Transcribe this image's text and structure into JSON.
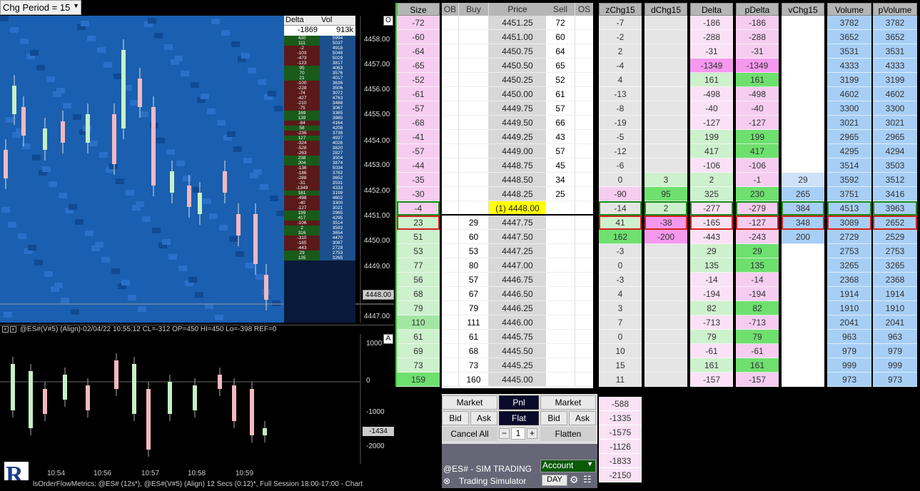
{
  "chart": {
    "period_label": "Chg Period = 15",
    "delta_header": "Delta",
    "vol_header": "Vol",
    "delta_total": "-1869",
    "vol_total": "913k",
    "o_button": "O",
    "a_button": "A",
    "price_axis": [
      "4458.00",
      "4457.00",
      "4456.00",
      "4455.00",
      "4454.00",
      "4453.00",
      "4452.00",
      "4451.00",
      "4450.00",
      "4449.00",
      "4447.00"
    ],
    "current_price_tag": "4448.00",
    "lower_header": "@ES#(V#5) (Align)-02/04/22 10:55:12 CL=-312 OP=450 HI=450 Lo=-398  REF=0",
    "osc_axis": [
      "1000",
      "0",
      "-1000",
      "-2000"
    ],
    "osc_tag": "-1434",
    "time_axis": [
      "10:54",
      "10:56",
      "10:57",
      "10:58",
      "10:59"
    ],
    "status_text": "lsOrderFlowMetrics: @ES# (12s*), @ES#(V#5) (Align) 12 Secs (0:12)*, Full Session 18:00-17:00 - Chart",
    "logo_letter": "R",
    "dv_rows": [
      [
        "430",
        "5994"
      ],
      [
        "111",
        "5037"
      ],
      [
        "-2",
        "4918"
      ],
      [
        "-103",
        "5049"
      ],
      [
        "-473",
        "5029"
      ],
      [
        "-123",
        "3817"
      ],
      [
        "95",
        "4063"
      ],
      [
        "70",
        "3576"
      ],
      [
        "21",
        "4017"
      ],
      [
        "-100",
        "3636"
      ],
      [
        "-228",
        "3506"
      ],
      [
        "-74",
        "3072"
      ],
      [
        "-427",
        "4763"
      ],
      [
        "-210",
        "3488"
      ],
      [
        "-75",
        "3067"
      ],
      [
        "169",
        "3365"
      ],
      [
        "139",
        "3985"
      ],
      [
        "-84",
        "4164"
      ],
      [
        "58",
        "4208"
      ],
      [
        "-236",
        "3738"
      ],
      [
        "127",
        "4937"
      ],
      [
        "-324",
        "4026"
      ],
      [
        "-528",
        "3820"
      ],
      [
        "-263",
        "2827"
      ],
      [
        "238",
        "3504"
      ],
      [
        "204",
        "3874"
      ],
      [
        "-136",
        "5034"
      ],
      [
        "-186",
        "3782"
      ],
      [
        "-288",
        "3652"
      ],
      [
        "-31",
        "3531"
      ],
      [
        "-1349",
        "4333"
      ],
      [
        "161",
        "3199"
      ],
      [
        "-498",
        "4602"
      ],
      [
        "-40",
        "3300"
      ],
      [
        "-127",
        "3021"
      ],
      [
        "199",
        "2965"
      ],
      [
        "417",
        "4295"
      ],
      [
        "-106",
        "3514"
      ],
      [
        "2",
        "3592"
      ],
      [
        "316",
        "3654"
      ],
      [
        "-310",
        "4470"
      ],
      [
        "-165",
        "3087"
      ],
      [
        "-443",
        "2729"
      ],
      [
        "29",
        "2753"
      ],
      [
        "135",
        "3265"
      ]
    ]
  },
  "dom": {
    "headers": {
      "size": "Size",
      "ob": "OB",
      "buy": "Buy",
      "price": "Price",
      "sell": "Sell",
      "os": "OS",
      "zchg": "zChg15",
      "dchg": "dChg15",
      "delta": "Delta",
      "pdelta": "pDelta",
      "vchg": "vChg15",
      "volume": "Volume",
      "pvolume": "pVolume"
    },
    "rows": [
      {
        "size": "-72",
        "buy": "",
        "price": "4451.25",
        "sell": "72",
        "z": "-7",
        "d": "",
        "delta": "-186",
        "pd": "-186",
        "v": "",
        "vol": "3782",
        "pv": "3782"
      },
      {
        "size": "-60",
        "buy": "",
        "price": "4451.00",
        "sell": "60",
        "z": "-2",
        "d": "",
        "delta": "-288",
        "pd": "-288",
        "v": "",
        "vol": "3652",
        "pv": "3652"
      },
      {
        "size": "-64",
        "buy": "",
        "price": "4450.75",
        "sell": "64",
        "z": "2",
        "d": "",
        "delta": "-31",
        "pd": "-31",
        "v": "",
        "vol": "3531",
        "pv": "3531"
      },
      {
        "size": "-65",
        "buy": "",
        "price": "4450.50",
        "sell": "65",
        "z": "-4",
        "d": "",
        "delta": "-1349",
        "pd": "-1349",
        "v": "",
        "vol": "4333",
        "pv": "4333"
      },
      {
        "size": "-52",
        "buy": "",
        "price": "4450.25",
        "sell": "52",
        "z": "4",
        "d": "",
        "delta": "161",
        "pd": "161",
        "v": "",
        "vol": "3199",
        "pv": "3199"
      },
      {
        "size": "-61",
        "buy": "",
        "price": "4450.00",
        "sell": "61",
        "z": "-13",
        "d": "",
        "delta": "-498",
        "pd": "-498",
        "v": "",
        "vol": "4602",
        "pv": "4602"
      },
      {
        "size": "-57",
        "buy": "",
        "price": "4449.75",
        "sell": "57",
        "z": "-8",
        "d": "",
        "delta": "-40",
        "pd": "-40",
        "v": "",
        "vol": "3300",
        "pv": "3300"
      },
      {
        "size": "-68",
        "buy": "",
        "price": "4449.50",
        "sell": "66",
        "z": "-19",
        "d": "",
        "delta": "-127",
        "pd": "-127",
        "v": "",
        "vol": "3021",
        "pv": "3021"
      },
      {
        "size": "-41",
        "buy": "",
        "price": "4449.25",
        "sell": "43",
        "z": "-5",
        "d": "",
        "delta": "199",
        "pd": "199",
        "v": "",
        "vol": "2965",
        "pv": "2965"
      },
      {
        "size": "-57",
        "buy": "",
        "price": "4449.00",
        "sell": "57",
        "z": "-12",
        "d": "",
        "delta": "417",
        "pd": "417",
        "v": "",
        "vol": "4295",
        "pv": "4294"
      },
      {
        "size": "-44",
        "buy": "",
        "price": "4448.75",
        "sell": "45",
        "z": "-6",
        "d": "",
        "delta": "-106",
        "pd": "-106",
        "v": "",
        "vol": "3514",
        "pv": "3503"
      },
      {
        "size": "-35",
        "buy": "",
        "price": "4448.50",
        "sell": "34",
        "z": "0",
        "d": "3",
        "delta": "2",
        "pd": "-1",
        "v": "29",
        "vol": "3592",
        "pv": "3512"
      },
      {
        "size": "-30",
        "buy": "",
        "price": "4448.25",
        "sell": "25",
        "z": "-90",
        "d": "95",
        "delta": "325",
        "pd": "230",
        "v": "265",
        "vol": "3751",
        "pv": "3416"
      },
      {
        "size": "-4",
        "buy": "",
        "price": "(1) 4448.00",
        "sell": "",
        "z": "-14",
        "d": "2",
        "delta": "-277",
        "pd": "-279",
        "v": "384",
        "vol": "4513",
        "pv": "3963"
      },
      {
        "size": "23",
        "buy": "29",
        "price": "4447.75",
        "sell": "",
        "z": "41",
        "d": "-38",
        "delta": "-165",
        "pd": "-127",
        "v": "348",
        "vol": "3089",
        "pv": "2652"
      },
      {
        "size": "51",
        "buy": "60",
        "price": "4447.50",
        "sell": "",
        "z": "162",
        "d": "-200",
        "delta": "-443",
        "pd": "-243",
        "v": "200",
        "vol": "2729",
        "pv": "2529"
      },
      {
        "size": "53",
        "buy": "53",
        "price": "4447.25",
        "sell": "",
        "z": "-3",
        "d": "",
        "delta": "29",
        "pd": "29",
        "v": "",
        "vol": "2753",
        "pv": "2753"
      },
      {
        "size": "77",
        "buy": "80",
        "price": "4447.00",
        "sell": "",
        "z": "0",
        "d": "",
        "delta": "135",
        "pd": "135",
        "v": "",
        "vol": "3265",
        "pv": "3265"
      },
      {
        "size": "56",
        "buy": "57",
        "price": "4446.75",
        "sell": "",
        "z": "-3",
        "d": "",
        "delta": "-14",
        "pd": "-14",
        "v": "",
        "vol": "2368",
        "pv": "2368"
      },
      {
        "size": "68",
        "buy": "67",
        "price": "4446.50",
        "sell": "",
        "z": "4",
        "d": "",
        "delta": "-194",
        "pd": "-194",
        "v": "",
        "vol": "1914",
        "pv": "1914"
      },
      {
        "size": "79",
        "buy": "79",
        "price": "4446.25",
        "sell": "",
        "z": "3",
        "d": "",
        "delta": "82",
        "pd": "82",
        "v": "",
        "vol": "1910",
        "pv": "1910"
      },
      {
        "size": "110",
        "buy": "111",
        "price": "4446.00",
        "sell": "",
        "z": "7",
        "d": "",
        "delta": "-713",
        "pd": "-713",
        "v": "",
        "vol": "2041",
        "pv": "2041"
      },
      {
        "size": "61",
        "buy": "61",
        "price": "4445.75",
        "sell": "",
        "z": "0",
        "d": "",
        "delta": "79",
        "pd": "79",
        "v": "",
        "vol": "963",
        "pv": "963"
      },
      {
        "size": "69",
        "buy": "68",
        "price": "4445.50",
        "sell": "",
        "z": "10",
        "d": "",
        "delta": "-61",
        "pd": "-61",
        "v": "",
        "vol": "979",
        "pv": "979"
      },
      {
        "size": "73",
        "buy": "73",
        "price": "4445.25",
        "sell": "",
        "z": "15",
        "d": "",
        "delta": "161",
        "pd": "161",
        "v": "",
        "vol": "999",
        "pv": "999"
      },
      {
        "size": "159",
        "buy": "160",
        "price": "4445.00",
        "sell": "",
        "z": "11",
        "d": "",
        "delta": "-157",
        "pd": "-157",
        "v": "",
        "vol": "973",
        "pv": "973"
      }
    ],
    "z_totals": [
      "-588",
      "-1335",
      "-1575",
      "-1126",
      "-1833",
      "-2150"
    ],
    "trade": {
      "market_buy": "Market",
      "pnl": "Pnl",
      "market_sell": "Market",
      "bid": "Bid",
      "ask": "Ask",
      "flat": "Flat",
      "bid2": "Bid",
      "ask2": "Ask",
      "cancel_all": "Cancel All",
      "qty": "1",
      "minus": "−",
      "plus": "+",
      "flatten": "Flatten",
      "symbol": "@ES# - SIM TRADING",
      "account": "Account",
      "simulator": "Trading Simulator",
      "day": "DAY"
    }
  }
}
